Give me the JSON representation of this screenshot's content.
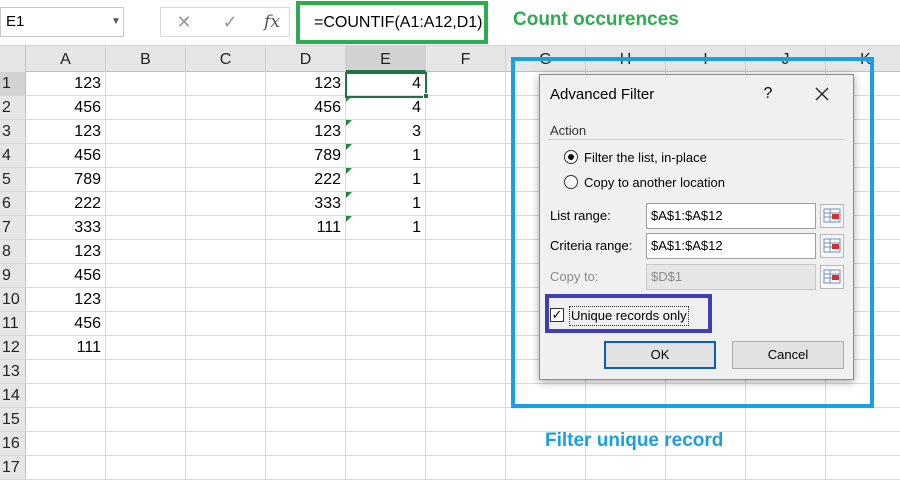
{
  "formula_bar": {
    "name_box": "E1",
    "name_box_arrow": "▼",
    "cancel_glyph": "✕",
    "enter_glyph": "✓",
    "fx_glyph": "fx",
    "formula": "=COUNTIF(A1:A12,D1)"
  },
  "annotations": {
    "count_note": "Count occurences",
    "filter_note": "Filter unique record",
    "count_color": "#2fac4f",
    "filter_color": "#19a0e0",
    "unique_frame_color": "#3f3fb5"
  },
  "sheet": {
    "columns": [
      "A",
      "B",
      "C",
      "D",
      "E",
      "F",
      "G",
      "H",
      "I",
      "J",
      "K"
    ],
    "selected_column": "E",
    "rows": [
      "1",
      "2",
      "3",
      "4",
      "5",
      "6",
      "7",
      "8",
      "9",
      "10",
      "11",
      "12",
      "13",
      "14",
      "15",
      "16",
      "17"
    ],
    "selected_row": "1",
    "col_a": [
      "123",
      "456",
      "123",
      "456",
      "789",
      "222",
      "333",
      "123",
      "456",
      "123",
      "456",
      "111"
    ],
    "col_d": [
      "123",
      "456",
      "123",
      "789",
      "222",
      "333",
      "111"
    ],
    "col_e": [
      "4",
      "4",
      "3",
      "1",
      "1",
      "1",
      "1"
    ],
    "active_cell": "E1"
  },
  "dialog": {
    "title": "Advanced Filter",
    "help": "?",
    "close_icon": "close-icon",
    "action_label": "Action",
    "options": [
      {
        "label": "Filter the list, in-place",
        "selected": true
      },
      {
        "label": "Copy to another location",
        "selected": false
      }
    ],
    "list_range_label": "List range:",
    "list_range_value": "$A$1:$A$12",
    "criteria_range_label": "Criteria range:",
    "criteria_range_value": "$A$1:$A$12",
    "copy_to_label": "Copy to:",
    "copy_to_value": "$D$1",
    "unique_label": "Unique records only",
    "unique_checked": true,
    "check_glyph": "✓",
    "ok_label": "OK",
    "cancel_label": "Cancel"
  }
}
